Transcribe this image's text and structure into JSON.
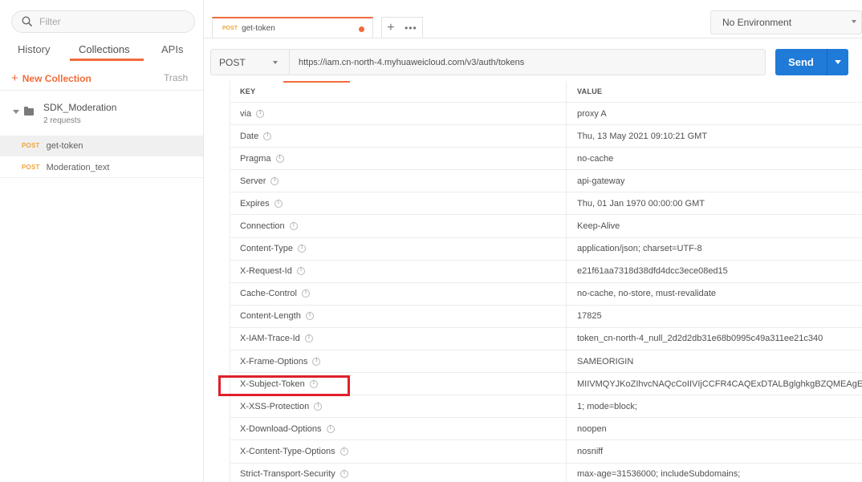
{
  "sidebar": {
    "filter_placeholder": "Filter",
    "tabs": [
      {
        "label": "History"
      },
      {
        "label": "Collections"
      },
      {
        "label": "APIs"
      }
    ],
    "active_tab": "Collections",
    "new_collection_label": "New Collection",
    "trash_label": "Trash",
    "collection": {
      "name": "SDK_Moderation",
      "count": "2 requests"
    },
    "requests": [
      {
        "method": "POST",
        "name": "get-token"
      },
      {
        "method": "POST",
        "name": "Moderation_text"
      }
    ]
  },
  "tab_bar": {
    "tab": {
      "method": "POST",
      "name": "get-token"
    },
    "add_label": "+",
    "more_label": "•••"
  },
  "environment": {
    "selected": "No Environment"
  },
  "request": {
    "method": "POST",
    "url": "https://iam.cn-north-4.myhuaweicloud.com/v3/auth/tokens",
    "send_label": "Send"
  },
  "headers_table": {
    "key_header": "KEY",
    "value_header": "VALUE",
    "rows": [
      {
        "key": "via",
        "value": "proxy A"
      },
      {
        "key": "Date",
        "value": "Thu, 13 May 2021 09:10:21 GMT"
      },
      {
        "key": "Pragma",
        "value": "no-cache"
      },
      {
        "key": "Server",
        "value": "api-gateway"
      },
      {
        "key": "Expires",
        "value": "Thu, 01 Jan 1970 00:00:00 GMT"
      },
      {
        "key": "Connection",
        "value": "Keep-Alive"
      },
      {
        "key": "Content-Type",
        "value": "application/json; charset=UTF-8"
      },
      {
        "key": "X-Request-Id",
        "value": "e21f61aa7318d38dfd4dcc3ece08ed15"
      },
      {
        "key": "Cache-Control",
        "value": "no-cache, no-store, must-revalidate"
      },
      {
        "key": "Content-Length",
        "value": "17825"
      },
      {
        "key": "X-IAM-Trace-Id",
        "value": "token_cn-north-4_null_2d2d2db31e68b0995c49a311ee21c340"
      },
      {
        "key": "X-Frame-Options",
        "value": "SAMEORIGIN"
      },
      {
        "key": "X-Subject-Token",
        "value": "MIIVMQYJKoZIhvcNAQcCoIIVIjCCFR4CAQExDTALBglghkgBZQMEAgE"
      },
      {
        "key": "X-XSS-Protection",
        "value": "1; mode=block;"
      },
      {
        "key": "X-Download-Options",
        "value": "noopen"
      },
      {
        "key": "X-Content-Type-Options",
        "value": "nosniff"
      },
      {
        "key": "Strict-Transport-Security",
        "value": "max-age=31536000; includeSubdomains;"
      }
    ],
    "highlighted_key": "X-Subject-Token",
    "highlight_color": "#e0202a"
  },
  "colors": {
    "accent": "#f26b3a",
    "send_button": "#1f7ad8",
    "post_method": "#f0a43a"
  }
}
